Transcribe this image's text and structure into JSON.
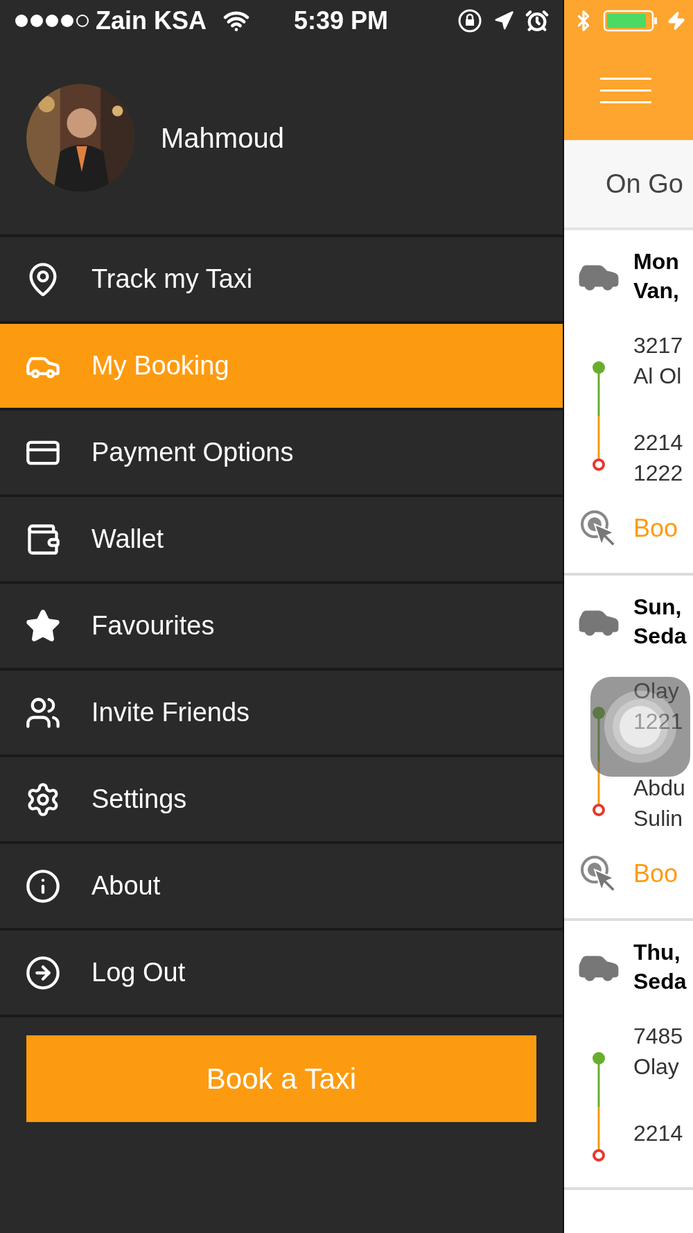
{
  "status_bar": {
    "carrier": "Zain KSA",
    "time": "5:39 PM"
  },
  "profile": {
    "name": "Mahmoud"
  },
  "menu": [
    {
      "label": "Track my Taxi",
      "kind": "track",
      "selected": false
    },
    {
      "label": "My Booking",
      "kind": "car",
      "selected": true
    },
    {
      "label": "Payment Options",
      "kind": "card",
      "selected": false
    },
    {
      "label": "Wallet",
      "kind": "wallet",
      "selected": false
    },
    {
      "label": "Favourites",
      "kind": "star",
      "selected": false
    },
    {
      "label": "Invite Friends",
      "kind": "friends",
      "selected": false
    },
    {
      "label": "Settings",
      "kind": "settings",
      "selected": false
    },
    {
      "label": "About",
      "kind": "info",
      "selected": false
    },
    {
      "label": "Log Out",
      "kind": "logout",
      "selected": false
    }
  ],
  "book_button": "Book a Taxi",
  "bookings_panel": {
    "tab": "On Go",
    "bookings": [
      {
        "title": [
          "Mon",
          "Van,"
        ],
        "pickup": [
          "3217",
          "Al Ol"
        ],
        "dropoff": [
          "2214",
          "1222"
        ],
        "action": "Boo"
      },
      {
        "title": [
          "Sun,",
          "Seda"
        ],
        "pickup": [
          "Olay",
          "1221"
        ],
        "dropoff": [
          "Abdu",
          "Sulin"
        ],
        "action": "Boo"
      },
      {
        "title": [
          "Thu,",
          "Seda"
        ],
        "pickup": [
          "7485",
          "Olay"
        ],
        "dropoff": [
          "2214"
        ]
      }
    ]
  }
}
